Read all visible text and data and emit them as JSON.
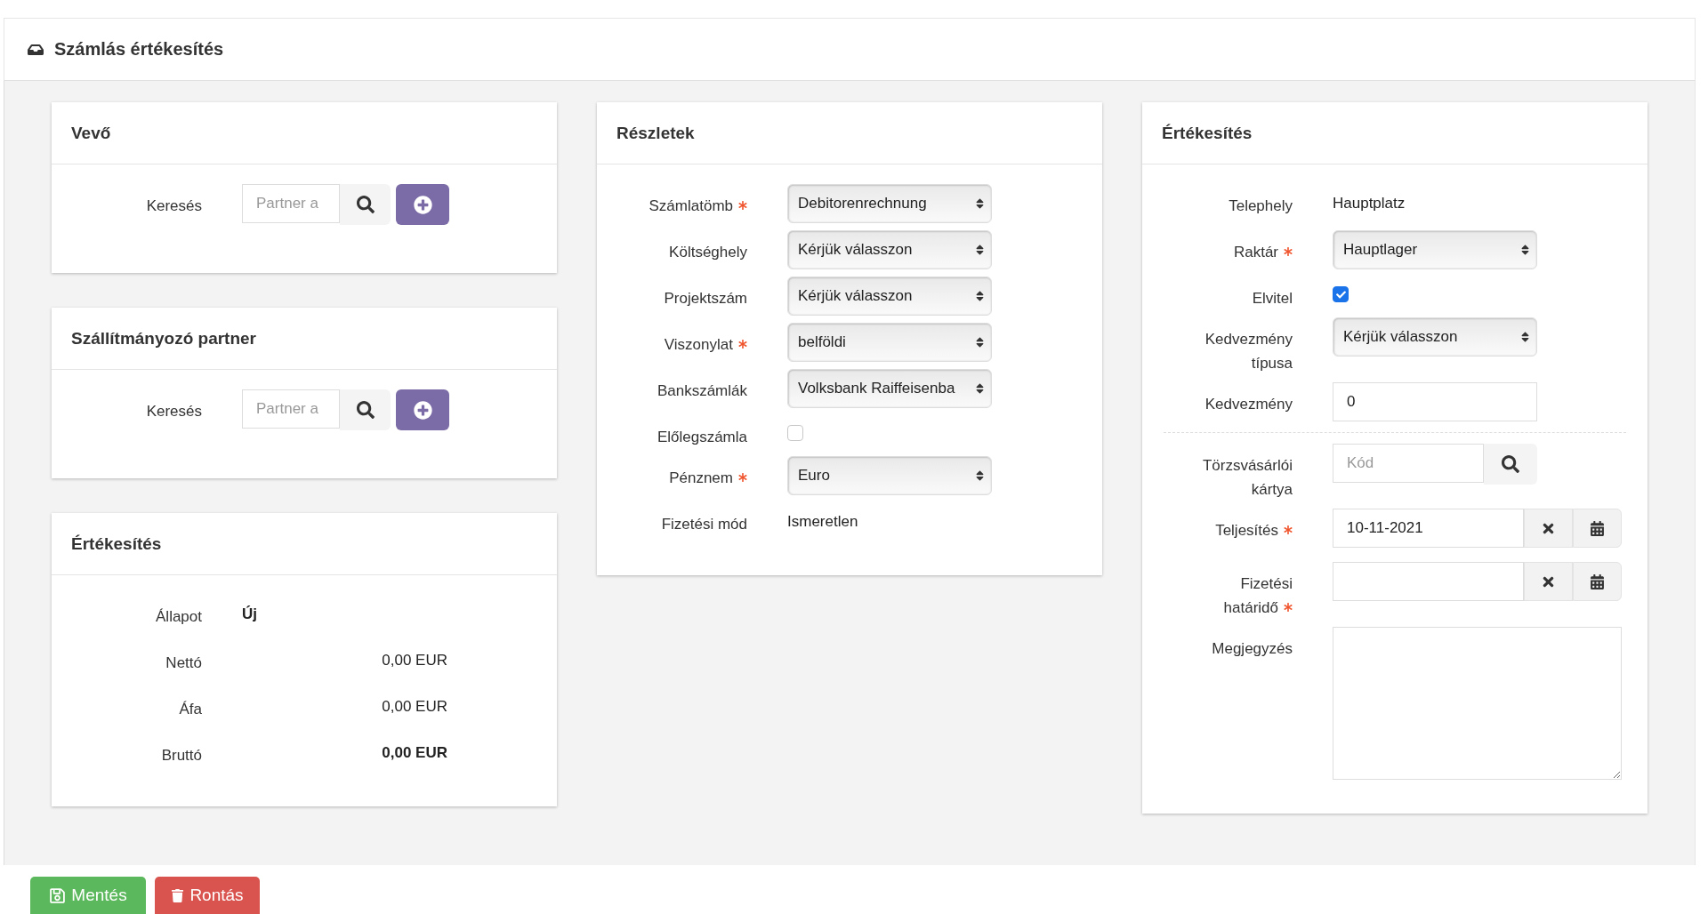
{
  "header": {
    "title": "Számlás értékesítés"
  },
  "columns": [
    {
      "cards": [
        {
          "title": "Vevő",
          "rows": [
            {
              "kind": "partner_search",
              "label": "Keresés",
              "placeholder": "Partner a",
              "required": false
            }
          ]
        },
        {
          "title": "Szállítmányozó partner",
          "rows": [
            {
              "kind": "partner_search",
              "label": "Keresés",
              "placeholder": "Partner a",
              "required": false
            }
          ]
        },
        {
          "title": "Értékesítés",
          "rows": [
            {
              "kind": "status",
              "label": "Állapot",
              "value": "Új",
              "required": false
            },
            {
              "kind": "amount",
              "label": "Nettó",
              "value": "0,00 EUR",
              "bold": false,
              "required": false
            },
            {
              "kind": "amount",
              "label": "Áfa",
              "value": "0,00 EUR",
              "bold": false,
              "required": false
            },
            {
              "kind": "amount",
              "label": "Bruttó",
              "value": "0,00 EUR",
              "bold": true,
              "required": false
            }
          ]
        }
      ]
    },
    {
      "cards": [
        {
          "title": "Részletek",
          "rows": [
            {
              "kind": "select",
              "label": "Számlatömb",
              "value": "Debitorenrechnung",
              "required": true
            },
            {
              "kind": "select",
              "label": "Költséghely",
              "value": "Kérjük válasszon",
              "required": false
            },
            {
              "kind": "select",
              "label": "Projektszám",
              "value": "Kérjük válasszon",
              "required": false
            },
            {
              "kind": "select",
              "label": "Viszonylat",
              "value": "belföldi",
              "required": true
            },
            {
              "kind": "select",
              "label": "Bankszámlák",
              "value": "Volksbank Raiffeisenba",
              "required": false
            },
            {
              "kind": "checkbox",
              "label": "Előlegszámla",
              "checked": false,
              "required": false
            },
            {
              "kind": "select",
              "label": "Pénznem",
              "value": "Euro",
              "required": true
            },
            {
              "kind": "text",
              "label": "Fizetési mód",
              "value": "Ismeretlen",
              "required": false
            }
          ]
        }
      ]
    },
    {
      "cards": [
        {
          "title": "Értékesítés",
          "rows": [
            {
              "kind": "text",
              "label": "Telephely",
              "value": "Hauptplatz",
              "required": false
            },
            {
              "kind": "select",
              "label": "Raktár",
              "value": "Hauptlager",
              "required": true
            },
            {
              "kind": "checkbox",
              "label": "Elvitel",
              "checked": true,
              "required": false
            },
            {
              "kind": "select",
              "label": "Kedvezmény típusa",
              "value": "Kérjük válasszon",
              "required": false
            },
            {
              "kind": "input",
              "label": "Kedvezmény",
              "value": "0",
              "required": false
            },
            {
              "kind": "divider"
            },
            {
              "kind": "code_search",
              "label": "Törzsvásárlói kártya",
              "placeholder": "Kód",
              "required": false
            },
            {
              "kind": "date",
              "label": "Teljesítés",
              "value": "10-11-2021",
              "required": true
            },
            {
              "kind": "date",
              "label": "Fizetési határidő",
              "required": true
            },
            {
              "kind": "textarea",
              "label": "Megjegyzés",
              "required": false
            }
          ]
        }
      ]
    }
  ],
  "footer": {
    "buttons": [
      {
        "kind": "save",
        "label": "Mentés"
      },
      {
        "kind": "delete",
        "label": "Rontás"
      }
    ]
  }
}
